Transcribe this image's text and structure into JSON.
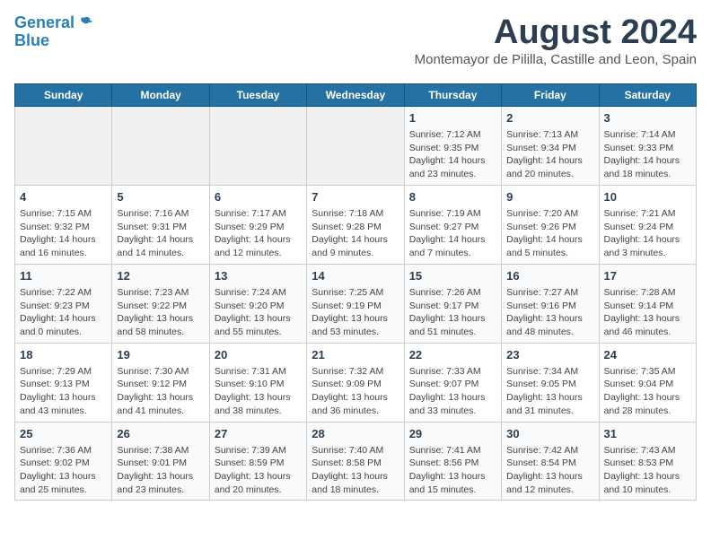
{
  "header": {
    "logo_line1": "General",
    "logo_line2": "Blue",
    "title": "August 2024",
    "subtitle": "Montemayor de Pililla, Castille and Leon, Spain"
  },
  "calendar": {
    "days_of_week": [
      "Sunday",
      "Monday",
      "Tuesday",
      "Wednesday",
      "Thursday",
      "Friday",
      "Saturday"
    ],
    "weeks": [
      [
        {
          "day": "",
          "info": ""
        },
        {
          "day": "",
          "info": ""
        },
        {
          "day": "",
          "info": ""
        },
        {
          "day": "",
          "info": ""
        },
        {
          "day": "1",
          "info": "Sunrise: 7:12 AM\nSunset: 9:35 PM\nDaylight: 14 hours\nand 23 minutes."
        },
        {
          "day": "2",
          "info": "Sunrise: 7:13 AM\nSunset: 9:34 PM\nDaylight: 14 hours\nand 20 minutes."
        },
        {
          "day": "3",
          "info": "Sunrise: 7:14 AM\nSunset: 9:33 PM\nDaylight: 14 hours\nand 18 minutes."
        }
      ],
      [
        {
          "day": "4",
          "info": "Sunrise: 7:15 AM\nSunset: 9:32 PM\nDaylight: 14 hours\nand 16 minutes."
        },
        {
          "day": "5",
          "info": "Sunrise: 7:16 AM\nSunset: 9:31 PM\nDaylight: 14 hours\nand 14 minutes."
        },
        {
          "day": "6",
          "info": "Sunrise: 7:17 AM\nSunset: 9:29 PM\nDaylight: 14 hours\nand 12 minutes."
        },
        {
          "day": "7",
          "info": "Sunrise: 7:18 AM\nSunset: 9:28 PM\nDaylight: 14 hours\nand 9 minutes."
        },
        {
          "day": "8",
          "info": "Sunrise: 7:19 AM\nSunset: 9:27 PM\nDaylight: 14 hours\nand 7 minutes."
        },
        {
          "day": "9",
          "info": "Sunrise: 7:20 AM\nSunset: 9:26 PM\nDaylight: 14 hours\nand 5 minutes."
        },
        {
          "day": "10",
          "info": "Sunrise: 7:21 AM\nSunset: 9:24 PM\nDaylight: 14 hours\nand 3 minutes."
        }
      ],
      [
        {
          "day": "11",
          "info": "Sunrise: 7:22 AM\nSunset: 9:23 PM\nDaylight: 14 hours\nand 0 minutes."
        },
        {
          "day": "12",
          "info": "Sunrise: 7:23 AM\nSunset: 9:22 PM\nDaylight: 13 hours\nand 58 minutes."
        },
        {
          "day": "13",
          "info": "Sunrise: 7:24 AM\nSunset: 9:20 PM\nDaylight: 13 hours\nand 55 minutes."
        },
        {
          "day": "14",
          "info": "Sunrise: 7:25 AM\nSunset: 9:19 PM\nDaylight: 13 hours\nand 53 minutes."
        },
        {
          "day": "15",
          "info": "Sunrise: 7:26 AM\nSunset: 9:17 PM\nDaylight: 13 hours\nand 51 minutes."
        },
        {
          "day": "16",
          "info": "Sunrise: 7:27 AM\nSunset: 9:16 PM\nDaylight: 13 hours\nand 48 minutes."
        },
        {
          "day": "17",
          "info": "Sunrise: 7:28 AM\nSunset: 9:14 PM\nDaylight: 13 hours\nand 46 minutes."
        }
      ],
      [
        {
          "day": "18",
          "info": "Sunrise: 7:29 AM\nSunset: 9:13 PM\nDaylight: 13 hours\nand 43 minutes."
        },
        {
          "day": "19",
          "info": "Sunrise: 7:30 AM\nSunset: 9:12 PM\nDaylight: 13 hours\nand 41 minutes."
        },
        {
          "day": "20",
          "info": "Sunrise: 7:31 AM\nSunset: 9:10 PM\nDaylight: 13 hours\nand 38 minutes."
        },
        {
          "day": "21",
          "info": "Sunrise: 7:32 AM\nSunset: 9:09 PM\nDaylight: 13 hours\nand 36 minutes."
        },
        {
          "day": "22",
          "info": "Sunrise: 7:33 AM\nSunset: 9:07 PM\nDaylight: 13 hours\nand 33 minutes."
        },
        {
          "day": "23",
          "info": "Sunrise: 7:34 AM\nSunset: 9:05 PM\nDaylight: 13 hours\nand 31 minutes."
        },
        {
          "day": "24",
          "info": "Sunrise: 7:35 AM\nSunset: 9:04 PM\nDaylight: 13 hours\nand 28 minutes."
        }
      ],
      [
        {
          "day": "25",
          "info": "Sunrise: 7:36 AM\nSunset: 9:02 PM\nDaylight: 13 hours\nand 25 minutes."
        },
        {
          "day": "26",
          "info": "Sunrise: 7:38 AM\nSunset: 9:01 PM\nDaylight: 13 hours\nand 23 minutes."
        },
        {
          "day": "27",
          "info": "Sunrise: 7:39 AM\nSunset: 8:59 PM\nDaylight: 13 hours\nand 20 minutes."
        },
        {
          "day": "28",
          "info": "Sunrise: 7:40 AM\nSunset: 8:58 PM\nDaylight: 13 hours\nand 18 minutes."
        },
        {
          "day": "29",
          "info": "Sunrise: 7:41 AM\nSunset: 8:56 PM\nDaylight: 13 hours\nand 15 minutes."
        },
        {
          "day": "30",
          "info": "Sunrise: 7:42 AM\nSunset: 8:54 PM\nDaylight: 13 hours\nand 12 minutes."
        },
        {
          "day": "31",
          "info": "Sunrise: 7:43 AM\nSunset: 8:53 PM\nDaylight: 13 hours\nand 10 minutes."
        }
      ]
    ]
  }
}
